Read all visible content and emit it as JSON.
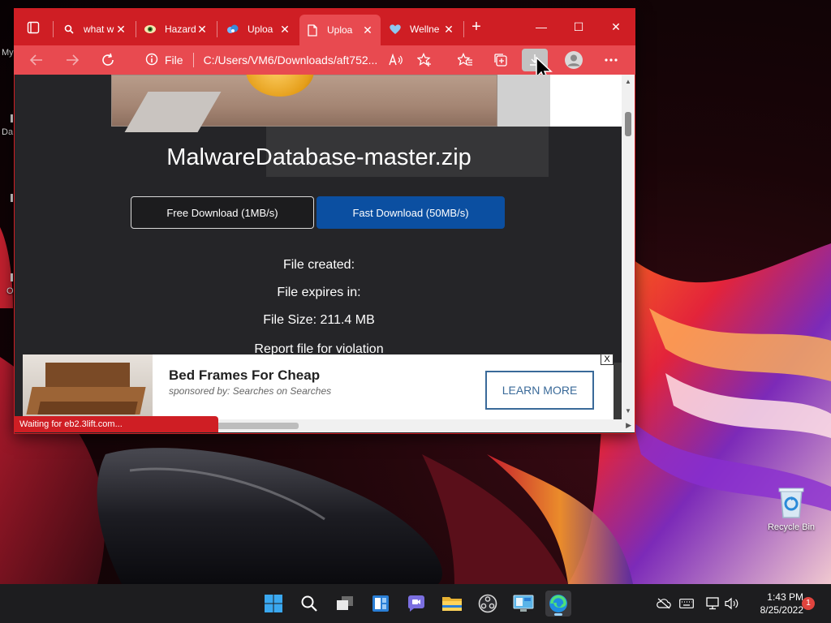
{
  "desktop": {
    "edge_fragments": [
      "My",
      "Da",
      "O"
    ],
    "recycle_bin_label": "Recycle Bin"
  },
  "browser": {
    "tabs": [
      {
        "title": "what w",
        "favicon": "search-icon"
      },
      {
        "title": "Hazard",
        "favicon": "hazard-eye-icon"
      },
      {
        "title": "Uploa",
        "favicon": "upload-cloud-icon"
      },
      {
        "title": "Uploa",
        "favicon": "page-icon",
        "active": true
      },
      {
        "title": "Wellne",
        "favicon": "heart-icon"
      }
    ],
    "address": {
      "scheme_label": "File",
      "url": "C:/Users/VM6/Downloads/aft752..."
    }
  },
  "page": {
    "file_title": "MalwareDatabase-master.zip",
    "free_download": "Free Download (1MB/s)",
    "fast_download": "Fast Download (50MB/s)",
    "file_created": "File created:",
    "file_expires": "File expires in:",
    "file_size": "File Size: 211.4 MB",
    "report_link": "Report file for violation"
  },
  "ad": {
    "title": "Bed Frames For Cheap",
    "sponsor": "sponsored by: Searches on Searches",
    "cta": "LEARN MORE",
    "close_glyph": "X"
  },
  "status_bar": "Waiting for eb2.3lift.com...",
  "taskbar": {
    "time": "1:43 PM",
    "date": "8/25/2022",
    "notification_count": "1"
  },
  "colors": {
    "browser_frame": "#cf1e24",
    "toolbar": "#e84a50",
    "page_bg": "#252528",
    "fast_button": "#0b4fa1",
    "learn_more": "#3a6a99"
  }
}
